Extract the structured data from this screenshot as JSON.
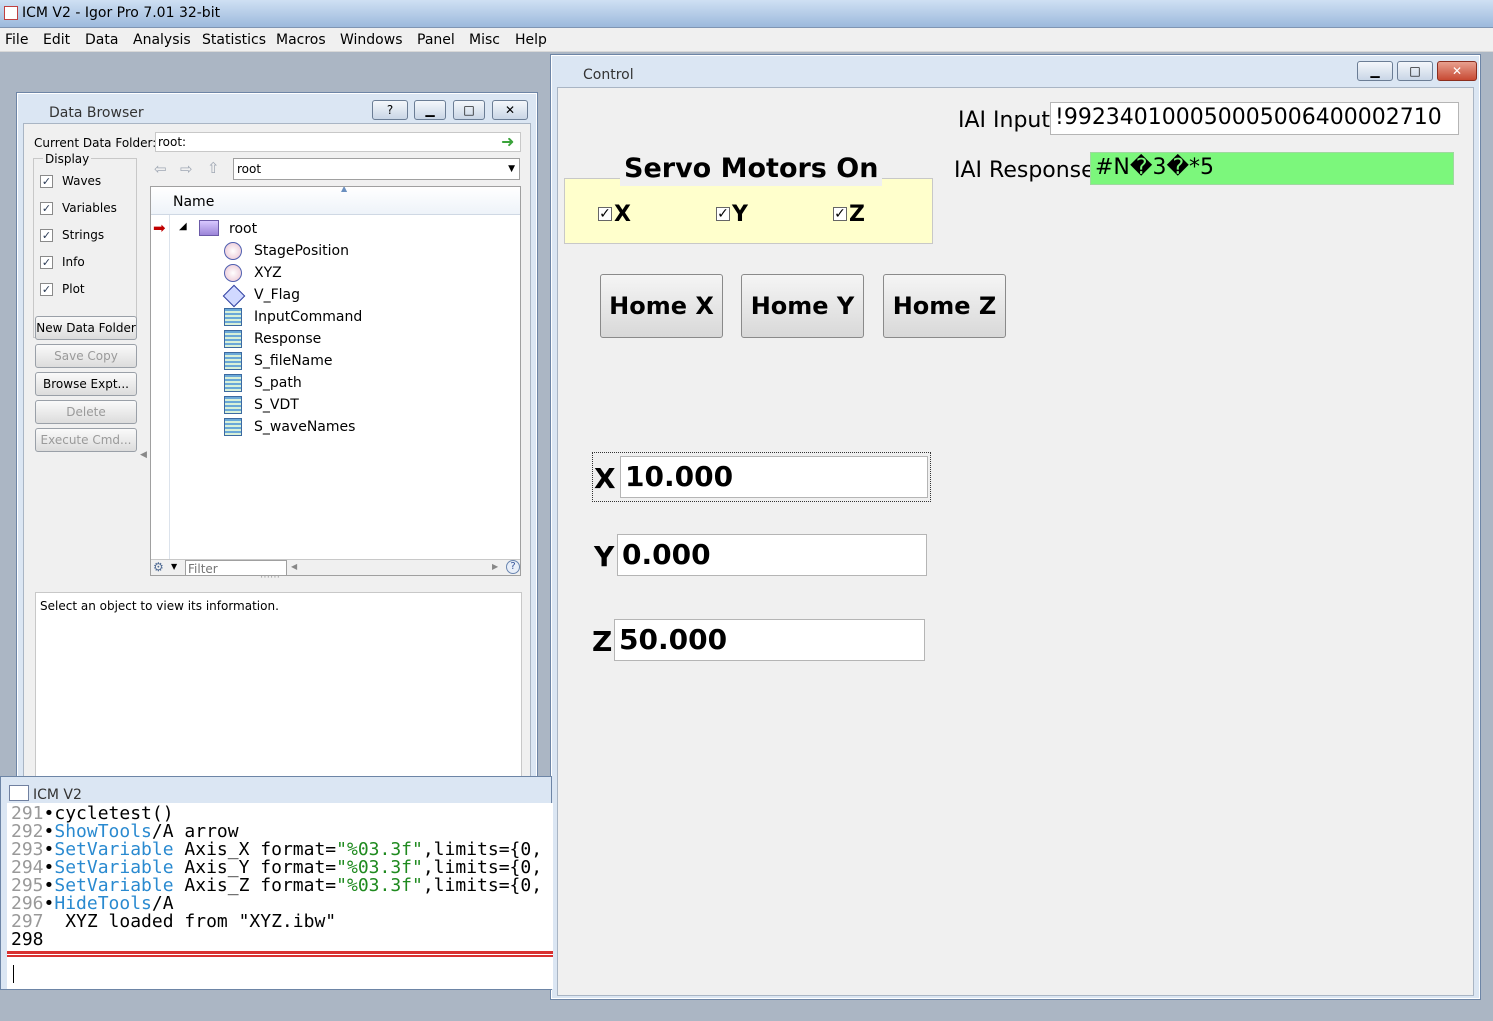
{
  "app": {
    "title": "ICM V2 - Igor Pro 7.01 32-bit",
    "menu": [
      "File",
      "Edit",
      "Data",
      "Analysis",
      "Statistics",
      "Macros",
      "Windows",
      "Panel",
      "Misc",
      "Help"
    ]
  },
  "data_browser": {
    "title": "Data Browser",
    "help_btn": "?",
    "current_folder_label": "Current Data Folder:",
    "current_folder_value": "root:",
    "display_label": "Display",
    "display_options": [
      "Waves",
      "Variables",
      "Strings",
      "Info",
      "Plot"
    ],
    "buttons": [
      "New Data Folder",
      "Save Copy",
      "Browse Expt...",
      "Delete",
      "Execute Cmd..."
    ],
    "folder_select": "root",
    "column_header": "Name",
    "root_label": "root",
    "items": [
      "StagePosition",
      "XYZ",
      "V_Flag",
      "InputCommand",
      "Response",
      "S_fileName",
      "S_path",
      "S_VDT",
      "S_waveNames"
    ],
    "filter_placeholder": "Filter",
    "info_text": "Select an object to view its information."
  },
  "control_panel": {
    "title": "Control",
    "iai_input_label": "IAI Input",
    "iai_input_value": "!992340100050005006400002710",
    "iai_response_label": "IAI Response",
    "iai_response_value": "#N�3�*5",
    "servo_title": "Servo Motors On",
    "servo_x": "X",
    "servo_y": "Y",
    "servo_z": "Z",
    "home_x": "Home X",
    "home_y": "Home Y",
    "home_z": "Home Z",
    "axis_x_label": "X",
    "axis_x_value": "10.000",
    "axis_y_label": "Y",
    "axis_y_value": "0.000",
    "axis_z_label": "Z",
    "axis_z_value": "50.000",
    "colors": {
      "response_bg": "#7cf77c",
      "servo_bg": "#ffffcc"
    }
  },
  "history": {
    "title": "ICM V2",
    "lines": [
      {
        "num": "291",
        "parts": [
          {
            "t": "•cycletest()",
            "c": "plain"
          }
        ]
      },
      {
        "num": "292",
        "parts": [
          {
            "t": "•",
            "c": "plain"
          },
          {
            "t": "ShowTools",
            "c": "kw"
          },
          {
            "t": "/A arrow",
            "c": "plain"
          }
        ]
      },
      {
        "num": "293",
        "parts": [
          {
            "t": "•",
            "c": "plain"
          },
          {
            "t": "SetVariable",
            "c": "kw"
          },
          {
            "t": " Axis_X format=",
            "c": "plain"
          },
          {
            "t": "\"%03.3f\"",
            "c": "str"
          },
          {
            "t": ",limits={0,",
            "c": "plain"
          }
        ]
      },
      {
        "num": "294",
        "parts": [
          {
            "t": "•",
            "c": "plain"
          },
          {
            "t": "SetVariable",
            "c": "kw"
          },
          {
            "t": " Axis_Y format=",
            "c": "plain"
          },
          {
            "t": "\"%03.3f\"",
            "c": "str"
          },
          {
            "t": ",limits={0,",
            "c": "plain"
          }
        ]
      },
      {
        "num": "295",
        "parts": [
          {
            "t": "•",
            "c": "plain"
          },
          {
            "t": "SetVariable",
            "c": "kw"
          },
          {
            "t": " Axis_Z format=",
            "c": "plain"
          },
          {
            "t": "\"%03.3f\"",
            "c": "str"
          },
          {
            "t": ",limits={0,",
            "c": "plain"
          }
        ]
      },
      {
        "num": "296",
        "parts": [
          {
            "t": "•",
            "c": "plain"
          },
          {
            "t": "HideTools",
            "c": "kw"
          },
          {
            "t": "/A",
            "c": "plain"
          }
        ]
      },
      {
        "num": "297",
        "parts": [
          {
            "t": "  XYZ loaded from \"XYZ.ibw\"",
            "c": "plain"
          }
        ]
      },
      {
        "num": "298",
        "parts": []
      }
    ]
  }
}
